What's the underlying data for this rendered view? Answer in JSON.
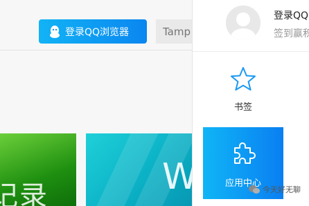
{
  "toolbar": {
    "login_label": "登录QQ浏览器",
    "search_placeholder": "Tamp"
  },
  "thumbnails": [
    {
      "text": "记录"
    },
    {
      "text": "W"
    }
  ],
  "panel": {
    "user_name": "登录QQ",
    "user_sub": "签到赢积",
    "bookmark_label": "书签",
    "app_center_label": "应用中心"
  },
  "watermark": {
    "text": "今天好无聊"
  }
}
